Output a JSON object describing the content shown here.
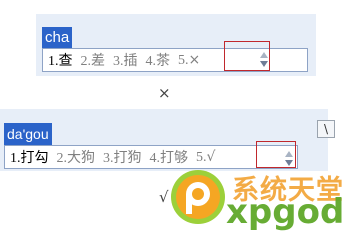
{
  "examples": [
    {
      "composition": "cha",
      "candidates": [
        {
          "num": "1.",
          "text": "查"
        },
        {
          "num": "2.",
          "text": "差"
        },
        {
          "num": "3.",
          "text": "插"
        },
        {
          "num": "4.",
          "text": "茶"
        },
        {
          "num": "5.",
          "text": "×"
        }
      ],
      "result_mark": "×"
    },
    {
      "composition": "da'gou",
      "candidates": [
        {
          "num": "1.",
          "text": "打勾"
        },
        {
          "num": "2.",
          "text": "大狗"
        },
        {
          "num": "3.",
          "text": "打狗"
        },
        {
          "num": "4.",
          "text": "打够"
        },
        {
          "num": "5.",
          "text": "√"
        }
      ],
      "result_mark": "√"
    }
  ],
  "backslash_key": "\\",
  "watermark": {
    "line1": "系统天堂",
    "line2": "xpgod"
  }
}
